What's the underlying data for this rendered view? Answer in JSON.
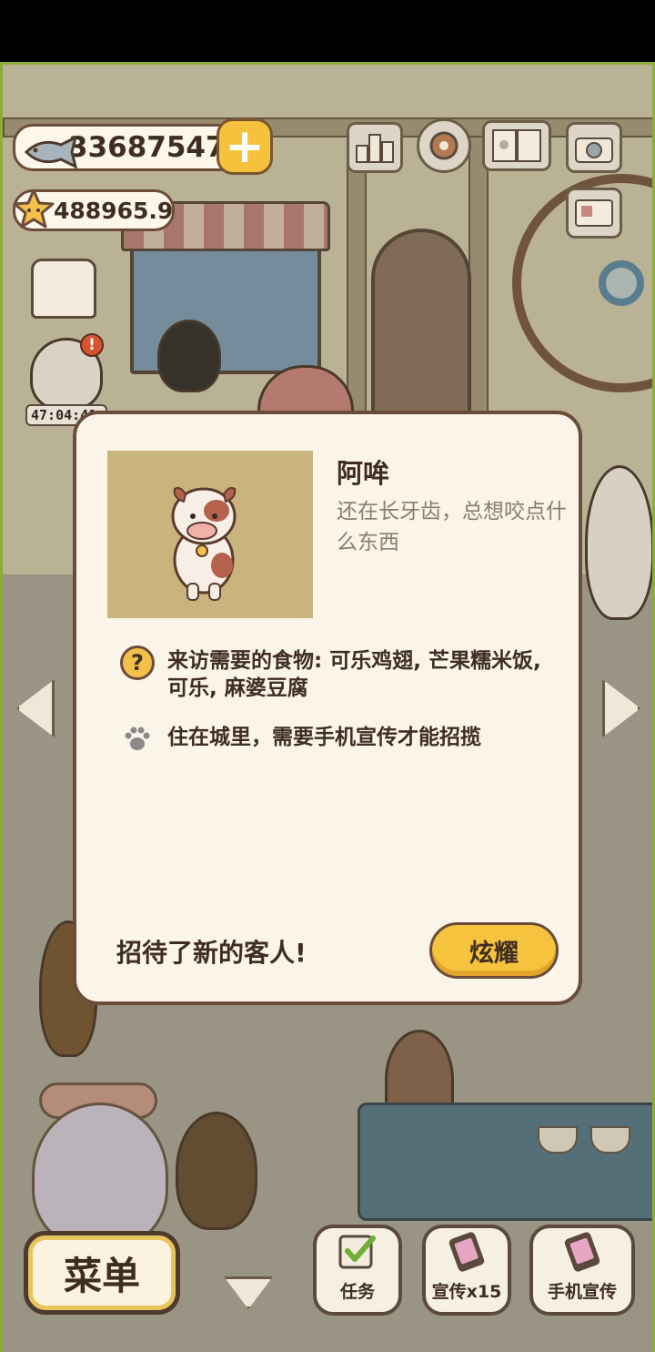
{
  "hud": {
    "fish_count": "33687547",
    "star_count": "488965.9",
    "timer": "47:04:41",
    "alert": "!"
  },
  "top_icons": [
    "ranking-icon",
    "settings-gear-icon",
    "album-book-icon",
    "camera-icon",
    "postcard-icon"
  ],
  "dialog": {
    "guest_name": "阿哞",
    "guest_description": "还在长牙齿，总想咬点什么东西",
    "food_label": "来访需要的食物: 可乐鸡翅, 芒果糯米饭, 可乐, 麻婆豆腐",
    "hint_label": "住在城里，需要手机宣传才能招揽",
    "question_mark": "?",
    "new_guest_text": "招待了新的客人!",
    "show_button_label": "炫耀"
  },
  "bottom_bar": {
    "menu_label": "菜单",
    "task_label": "任务",
    "promo_label": "宣传x15",
    "phone_promo_label": "手机宣传"
  },
  "colors": {
    "accent_yellow": "#f6c33f",
    "outline_brown": "#6b4b3a",
    "dialog_bg": "#fbf4e9",
    "portrait_bg": "#c9b47e"
  }
}
